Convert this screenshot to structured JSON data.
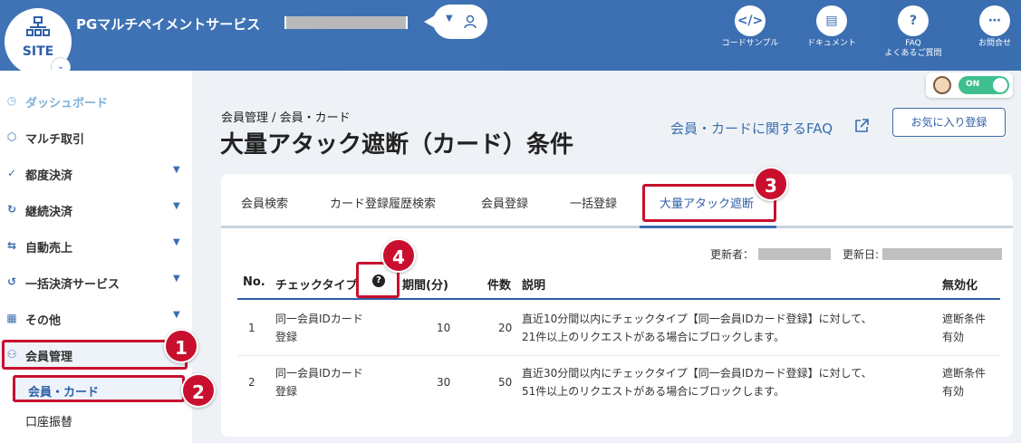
{
  "header": {
    "logo_text": "SITE",
    "app_title": "PGマルチペイメントサービス",
    "links": [
      {
        "icon": "code-icon",
        "label": "コードサンプル"
      },
      {
        "icon": "book-icon",
        "label": "ドキュメント"
      },
      {
        "icon": "question-icon",
        "label": "FAQ",
        "label2": "よくあるご質問"
      },
      {
        "icon": "chat-icon",
        "label": "お問合せ"
      }
    ]
  },
  "toggle": {
    "label": "ON",
    "state": "on"
  },
  "sidebar": {
    "items": [
      {
        "label": "ダッシュボード",
        "icon": "clock-icon"
      },
      {
        "label": "マルチ取引",
        "icon": "cube-icon"
      },
      {
        "label": "都度決済",
        "icon": "check-circle-icon"
      },
      {
        "label": "継続決済",
        "icon": "refresh-icon"
      },
      {
        "label": "自動売上",
        "icon": "swap-icon"
      },
      {
        "label": "一括決済サービス",
        "icon": "undo-icon"
      },
      {
        "label": "その他",
        "icon": "grid-icon"
      },
      {
        "label": "会員管理",
        "icon": "users-icon"
      }
    ],
    "sub_items": [
      {
        "label": "会員・カード"
      },
      {
        "label": "口座振替"
      }
    ]
  },
  "main": {
    "breadcrumb": "会員管理 / 会員・カード",
    "title": "大量アタック遮断（カード）条件",
    "faq_link": "会員・カードに関するFAQ",
    "favorite_button": "お気に入り登録",
    "tabs": [
      "会員検索",
      "カード登録履歴検索",
      "会員登録",
      "一括登録",
      "大量アタック遮断"
    ],
    "active_tab": "大量アタック遮断",
    "updated_by_label": "更新者：",
    "updated_date_label": "更新日:",
    "table": {
      "headers": [
        "No.",
        "チェックタイプ",
        "期間(分)",
        "件数",
        "説明",
        "無効化"
      ],
      "rows": [
        {
          "no": "1",
          "type_l1": "同一会員IDカード",
          "type_l2": "登録",
          "period": "10",
          "count": "20",
          "desc_l1": "直近10分間以内にチェックタイプ【同一会員IDカード登録】に対して、",
          "desc_l2": "21件以上のリクエストがある場合にブロックします。",
          "disable_l1": "遮断条件",
          "disable_l2": "有効"
        },
        {
          "no": "2",
          "type_l1": "同一会員IDカード",
          "type_l2": "登録",
          "period": "30",
          "count": "50",
          "desc_l1": "直近30分間以内にチェックタイプ【同一会員IDカード登録】に対して、",
          "desc_l2": "51件以上のリクエストがある場合にブロックします。",
          "disable_l1": "遮断条件",
          "disable_l2": "有効"
        }
      ]
    }
  },
  "callouts": [
    "1",
    "2",
    "3",
    "4"
  ],
  "colors": {
    "brand": "#3a6eb0",
    "callout": "#c8102e",
    "toggle_on": "#3fbf8f"
  }
}
